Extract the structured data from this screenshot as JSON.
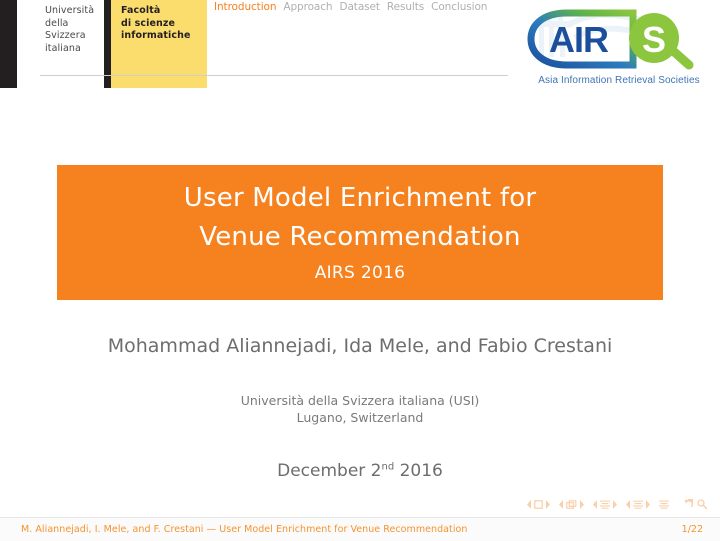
{
  "header": {
    "usi_logo": {
      "university_lines": "Università\ndella\nSvizzera\nitaliana",
      "faculty_lines": "Facoltà\ndi scienze\ninformatiche"
    },
    "nav_items": [
      {
        "label": "Introduction",
        "active": true
      },
      {
        "label": "Approach",
        "active": false
      },
      {
        "label": "Dataset",
        "active": false
      },
      {
        "label": "Results",
        "active": false
      },
      {
        "label": "Conclusion",
        "active": false
      }
    ],
    "airs_logo": {
      "wordmark": "AIR",
      "s_letter": "S",
      "tagline": "Asia Information Retrieval Societies"
    }
  },
  "title_block": {
    "line1": "User Model Enrichment for",
    "line2": "Venue Recommendation",
    "subtitle": "AIRS 2016"
  },
  "authors": "Mohammad Aliannejadi, Ida Mele, and Fabio Crestani",
  "affiliation": {
    "line1": "Università della Svizzera italiana (USI)",
    "line2": "Lugano, Switzerland"
  },
  "date": {
    "month_day": "December 2",
    "ordinal_suffix": "nd",
    "year": "2016"
  },
  "footer": {
    "text": "M. Aliannejadi, I. Mele, and F. Crestani — User Model Enrichment for Venue Recommendation",
    "page": "1/22"
  },
  "colors": {
    "accent_orange": "#f5821f",
    "footer_orange": "#f5932f",
    "usi_yellow": "#fbdd6e",
    "usi_black": "#231f20",
    "airs_blue": "#1b4f9c",
    "airs_green": "#8cc63f",
    "tagline_blue": "#3f74b5",
    "nav_inactive": "#b0b0b0",
    "body_grey": "#6d6d6d"
  },
  "icons": {
    "beamer_nav": [
      "slide-first-icon",
      "slide-prev-icon",
      "slide-next-icon",
      "frame-first-icon",
      "frame-prev-icon",
      "frame-next-icon",
      "subsection-first-icon",
      "subsection-prev-icon",
      "subsection-next-icon",
      "section-first-icon",
      "section-prev-icon",
      "section-next-icon",
      "doc-icon",
      "back-icon",
      "search-icon"
    ]
  }
}
